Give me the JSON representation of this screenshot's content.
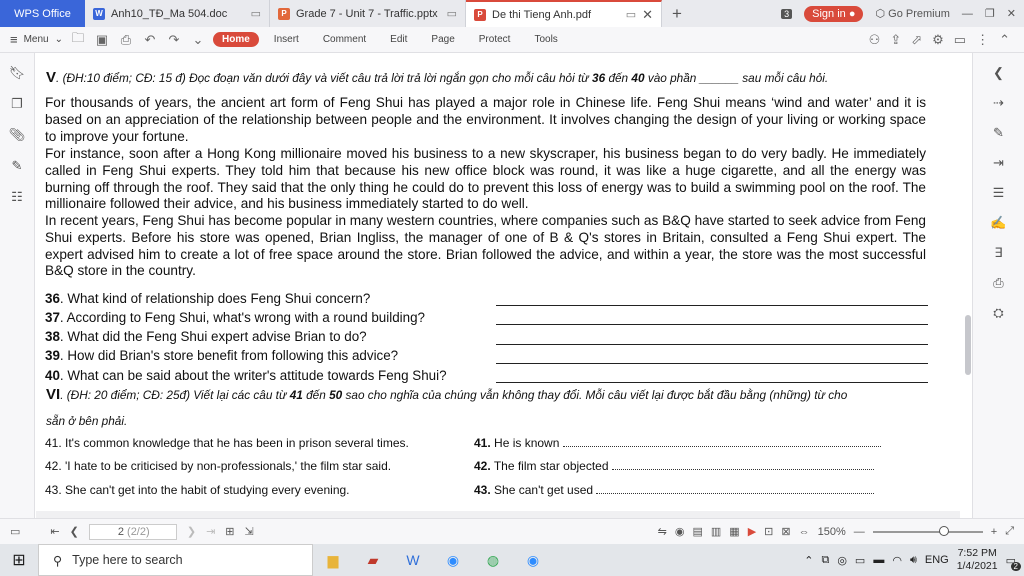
{
  "window": {
    "app_tab": "WPS Office",
    "tabs": [
      {
        "label": "Anh10_TĐ_Ma 504.doc",
        "icon": "W",
        "color": "#3a66d9"
      },
      {
        "label": "Grade 7 - Unit 7 - Traffic.pptx",
        "icon": "P",
        "color": "#e2683b"
      },
      {
        "label": "De thi Tieng Anh.pdf",
        "icon": "P",
        "color": "#d94a3b"
      }
    ],
    "tab_count": "3",
    "signin": "Sign in",
    "premium": "Go Premium"
  },
  "menu": {
    "menu_label": "Menu",
    "items": [
      "Home",
      "Insert",
      "Comment",
      "Edit",
      "Page",
      "Protect",
      "Tools"
    ]
  },
  "doc": {
    "sec5_num": "V",
    "sec5_text": ". (ĐH:10 điểm; CĐ: 15 đ)  Đọc đoạn văn dưới đây và  viết câu trả lời trả lời ngắn gọn cho mỗi câu hỏi từ",
    "sec5_bold1": "36",
    "sec5_mid": "đến",
    "sec5_bold2": "40",
    "sec5_tail": "vào phần  ______  sau  mỗi câu hỏi.",
    "para1": "For thousands of years, the ancient art form of Feng Shui has played a major role in Chinese life. Feng Shui means ‘wind and water’ and it is based on an appreciation of the relationship between people and the environment. It involves changing the design of your living or working space to improve your fortune.",
    "para2": "For instance, soon after a Hong Kong millionaire moved his business to a new skyscraper, his business began to do very badly. He immediately called in Feng Shui experts. They told him that because his new office block was round, it was like a huge cigarette, and all the energy was burning off through the roof. They said that the only thing he could do to prevent this loss of energy was to build a swimming pool on the roof. The millionaire followed their advice, and his business immediately started to do well.",
    "para3": "In recent years, Feng Shui has become popular in many western countries, where companies such as B&Q have started to seek advice from Feng Shui experts. Before his store was opened, Brian Ingliss, the manager of one of B & Q's stores in Britain, consulted a Feng Shui expert. The expert advised him to create a lot of free space around the store. Brian followed the advice, and within a year, the store was the most successful B&Q store in the country.",
    "questions": [
      {
        "n": "36",
        "t": ". What kind of relationship does Feng Shui concern?"
      },
      {
        "n": "37",
        "t": ". According to Feng Shui, what's wrong with a round building?"
      },
      {
        "n": "38",
        "t": ". What did the Feng Shui expert advise Brian to do?"
      },
      {
        "n": "39",
        "t": ". How did Brian's store benefit from following this advice?"
      },
      {
        "n": "40",
        "t": ". What can be said about the writer's attitude towards Feng Shui?"
      }
    ],
    "sec6_num": "VI",
    "sec6_text": ". (ĐH: 20 điểm; CĐ: 25đ) Viết lại các câu từ",
    "sec6_bold1": "41",
    "sec6_mid": "đến",
    "sec6_bold2": "50",
    "sec6_tail": "sao cho nghĩa của chúng vẫn không thay đổi. Mỗi câu viết lại được bắt đầu bằng  (những) từ  cho",
    "sec6_line2": "sẵn ở  bên  phải.",
    "rewrites": [
      {
        "left": "41. It's common knowledge that he has been in prison several times.",
        "n": "41.",
        "right": "He is known"
      },
      {
        "left": "42. 'I hate to be criticised by non-professionals,' the film star said.",
        "n": "42.",
        "right": "The film star objected"
      },
      {
        "left": "43. She can't get into the habit of studying every evening.",
        "n": "43.",
        "right": "She can't get used"
      }
    ]
  },
  "status": {
    "page_indicator": "2",
    "page_total": "(2/2)",
    "zoom": "150%"
  },
  "taskbar": {
    "search_placeholder": "Type here to search",
    "lang": "ENG",
    "time": "7:52 PM",
    "date": "1/4/2021",
    "notif": "2"
  }
}
